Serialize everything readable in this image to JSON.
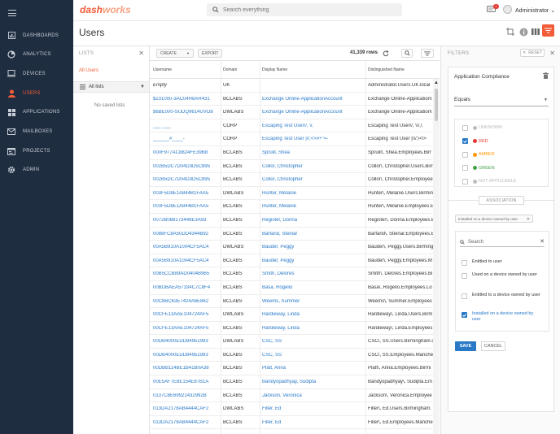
{
  "app": {
    "logo_part1": "dash",
    "logo_part2": "works",
    "search_placeholder": "Search everything",
    "notification_count": "1",
    "user_name": "Administrator",
    "user_caret": "⌄"
  },
  "sidebar": {
    "items": [
      {
        "label": "DASHBOARDS",
        "icon": "dashboard-icon"
      },
      {
        "label": "ANALYTICS",
        "icon": "analytics-icon"
      },
      {
        "label": "DEVICES",
        "icon": "devices-icon"
      },
      {
        "label": "USERS",
        "icon": "users-icon",
        "active": true
      },
      {
        "label": "APPLICATIONS",
        "icon": "applications-icon"
      },
      {
        "label": "MAILBOXES",
        "icon": "mailboxes-icon"
      },
      {
        "label": "PROJECTS",
        "icon": "projects-icon"
      },
      {
        "label": "ADMIN",
        "icon": "admin-icon"
      }
    ]
  },
  "page": {
    "title": "Users"
  },
  "lists_panel": {
    "title": "LISTS",
    "all_users": "All Users",
    "all_lists": "All lists",
    "no_saved": "No saved lists"
  },
  "toolbar": {
    "create_label": "CREATE",
    "export_label": "EXPORT",
    "rows_count": "41,339 rows"
  },
  "table": {
    "columns": [
      "Username",
      "Domain",
      "Display Name",
      "Distinguished Name"
    ],
    "rows": [
      {
        "username": "Empty",
        "domain": "UK",
        "display": "",
        "dn": "Administrator.Users.UK.local"
      },
      {
        "username": "$231000-3AC04R8AR431",
        "domain": "BCLABS",
        "display": "Exchange Online-ApplicationAccount",
        "dn": "Exchange Online-Application\\"
      },
      {
        "username": "$6BE000-SUDQ9614UVO8",
        "domain": "DWLABS",
        "display": "Exchange Online-ApplicationAccount",
        "dn": "Exchange Online-Application\\"
      },
      {
        "username": "___ ___",
        "domain": "CORP",
        "display": "Escaping Test User\\/, \\/,",
        "dn": "Escaping Test User\\/, \\\\/,\\"
      },
      {
        "username": "______#____-",
        "domain": "CORP",
        "display": "Escaping Test User |\\/;<>#+\"=-",
        "dn": "Escaping Test User |\\\\/;\\<\\>"
      },
      {
        "username": "000F977AC8824FE39B8",
        "domain": "BCLABS",
        "display": "Spruill, Shea",
        "dn": "Spruill\\, Shea.Employees.Birr"
      },
      {
        "username": "002B5DC7D04D3D5C895",
        "domain": "BCLABS",
        "display": "Collor, Christopher",
        "dn": "Collor\\, Christopher.Users.Birr"
      },
      {
        "username": "002B5DC7D04D3D5C895",
        "domain": "BCLABS",
        "display": "Collor, Christopher",
        "dn": "Collor\\, Christopher.Employee"
      },
      {
        "username": "003F5D8E1A844B1FAA5",
        "domain": "DWLABS",
        "display": "Hunter, Melanie",
        "dn": "Hunter\\, Melanie.Users.Birmin"
      },
      {
        "username": "003F5D8E1A844B1FAA5",
        "domain": "BCLABS",
        "display": "Hunter, Melanie",
        "dn": "Hunter\\, Melanie.Employees.E"
      },
      {
        "username": "0072B088173449E3A93",
        "domain": "BCLABS",
        "display": "Register, Donna",
        "dn": "Register\\, Donna.Employees.E"
      },
      {
        "username": "0088FC8A50DD4344B92",
        "domain": "BCLABS",
        "display": "Barfand, Steinar",
        "dn": "Barfand\\, Steinar.Employees.B"
      },
      {
        "username": "00A5B910A1004CF5AC4",
        "domain": "DWLABS",
        "display": "Bauder, Peggy",
        "dn": "Bauder\\, Peggy.Users.Birming"
      },
      {
        "username": "00A5B910A1004CF5AC4",
        "domain": "BCLABS",
        "display": "Bauder, Peggy",
        "dn": "Bauder\\, Peggy.Employees.M"
      },
      {
        "username": "00B5CCB89AD0404B965",
        "domain": "BCLABS",
        "display": "Smith, Delores",
        "dn": "Smith\\, Delores.Employees.Bi"
      },
      {
        "username": "00BDBAEA57334C7C8F4",
        "domain": "BCLABS",
        "display": "Basa, Rogelio",
        "dn": "Basa\\, Rogelio.Employees.Lo"
      },
      {
        "username": "00C8BC63E7424A6E862",
        "domain": "BCLABS",
        "display": "Weems, Summer",
        "dn": "Weems\\, Summer.Employees"
      },
      {
        "username": "00CFE13AAE104724AF5",
        "domain": "DWLABS",
        "display": "Hardieway, Linda",
        "dn": "Hardieway\\, Linda.Users.Birm"
      },
      {
        "username": "00CFE13AAE104724AF5",
        "domain": "BCLABS",
        "display": "Hardieway, Linda",
        "dn": "Hardieway\\, Linda.Employees"
      },
      {
        "username": "00DB4000EDD84951993",
        "domain": "DWLABS",
        "display": "CSC, SS",
        "dn": "CSC\\, SS.Users.Birmingham.c"
      },
      {
        "username": "00DB4000EDD84951993",
        "domain": "BCLABS",
        "display": "CSC, SS",
        "dn": "CSC\\, SS.Employees.Manche"
      },
      {
        "username": "00DBB114BE1B41B0A38",
        "domain": "BCLABS",
        "display": "Platt, Anna",
        "dn": "Platt\\, Anna.Employees.Birmi"
      },
      {
        "username": "00E5AF7E8E154E87B1A",
        "domain": "BCLABS",
        "display": "Bandyopadhyay, Sudipta",
        "dn": "Bandyopadhyay\\, Sudipta.Em"
      },
      {
        "username": "0137C8E69921432992B",
        "domain": "BCLABS",
        "display": "Jackson, Veronica",
        "dn": "Jackson\\, Veronica.Employee"
      },
      {
        "username": "013DA2178AB4444CAF2",
        "domain": "DWLABS",
        "display": "Filler, Ed",
        "dn": "Filler\\, Ed.Users.Birmingham."
      },
      {
        "username": "013DA2178AB4444CAF2",
        "domain": "BCLABS",
        "display": "Filler, Ed",
        "dn": "Filler\\, Ed.Employees.Manche"
      }
    ]
  },
  "filters": {
    "title": "FILTERS",
    "reset_label": "RESET",
    "box_title": "Application Compliance",
    "operator": "Equals",
    "options": [
      {
        "label": "UNKNOWN",
        "color": "#bdbdbd",
        "checked": false
      },
      {
        "label": "RED",
        "color": "#e53935",
        "checked": true
      },
      {
        "label": "AMBER",
        "color": "#ff9800",
        "checked": false
      },
      {
        "label": "GREEN",
        "color": "#43a047",
        "checked": false
      },
      {
        "label": "NOT APPLICABLE",
        "color": "#bdbdbd",
        "checked": false
      }
    ],
    "association_label": "ASSOCIATION",
    "chip_label": "Installed on a device owned by user",
    "association_search_placeholder": "Search",
    "association_items": [
      {
        "label": "Entitled to user",
        "checked": false
      },
      {
        "label": "Used on a device owned by user",
        "checked": false
      },
      {
        "label": "Entitled to a device owned by user",
        "checked": false
      },
      {
        "label": "Installed on a device owned by user",
        "checked": true
      }
    ],
    "save_label": "SAVE",
    "cancel_label": "CANCEL"
  },
  "colors": {
    "accent": "#f25c38",
    "link": "#2979c7",
    "sidebar": "#1f2d40"
  }
}
